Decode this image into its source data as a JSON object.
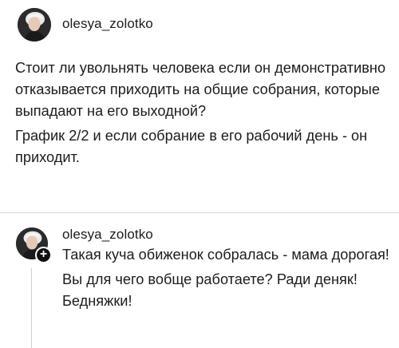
{
  "post": {
    "username": "olesya_zolotko",
    "avatar_icon": "user-avatar-photo",
    "paragraphs": [
      "Стоит ли увольнять человека если он демонстративно отказывается приходить на общие собрания, которые выпадают на его выходной?",
      "График 2/2 и если собрание в его рабочий день - он приходит."
    ]
  },
  "reply": {
    "username": "olesya_zolotko",
    "avatar_icon": "user-avatar-photo",
    "badge_icon": "plus-icon",
    "badge_glyph": "+",
    "paragraphs": [
      "Такая куча обиженок собралась - мама дорогая!",
      "Вы для чего вобще работаете? Ради деняк! Бедняжки!"
    ]
  }
}
